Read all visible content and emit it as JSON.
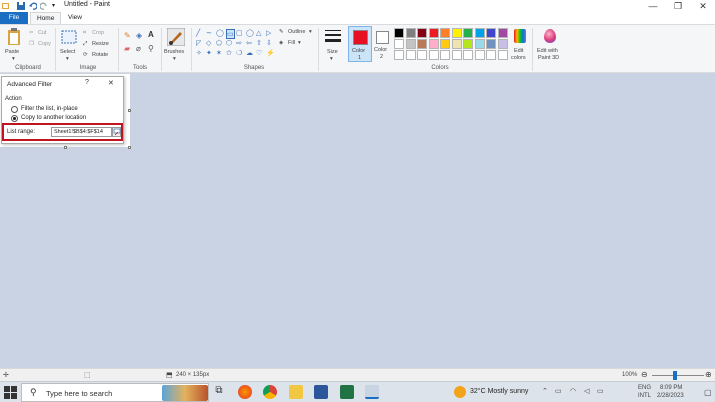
{
  "window": {
    "title": "Untitled - Paint",
    "controls": {
      "minimize": "—",
      "maximize": "❐",
      "close": "✕"
    }
  },
  "tabs": {
    "file": "File",
    "home": "Home",
    "view": "View"
  },
  "ribbon": {
    "clipboard": {
      "label": "Clipboard",
      "paste": "Paste",
      "cut": "Cut",
      "copy": "Copy"
    },
    "image": {
      "label": "Image",
      "select": "Select",
      "crop": "Crop",
      "resize": "Resize",
      "rotate": "Rotate"
    },
    "tools": {
      "label": "Tools"
    },
    "brushes": "Brushes",
    "shapes": {
      "label": "Shapes",
      "outline": "Outline",
      "fill": "Fill"
    },
    "size": "Size",
    "color1": {
      "label": "Color",
      "num": "1",
      "value": "#e81123"
    },
    "color2": {
      "label": "Color",
      "num": "2",
      "value": "#ffffff"
    },
    "colors": {
      "label": "Colors",
      "row1": [
        "#000000",
        "#7f7f7f",
        "#880015",
        "#ed1c24",
        "#ff7f27",
        "#fff200",
        "#22b14c",
        "#00a2e8",
        "#3f48cc",
        "#a349a4"
      ],
      "row2": [
        "#ffffff",
        "#c3c3c3",
        "#b97a57",
        "#ffaec9",
        "#ffc90e",
        "#efe4b0",
        "#b5e61d",
        "#99d9ea",
        "#7092be",
        "#c8bfe7"
      ]
    },
    "edit_colors": {
      "line1": "Edit",
      "line2": "colors"
    },
    "paint3d": {
      "line1": "Edit with",
      "line2": "Paint 3D"
    }
  },
  "dialog": {
    "title": "Advanced Filter",
    "help": "?",
    "close": "✕",
    "action_label": "Action",
    "option1": "Filter the list, in-place",
    "option2": "Copy to another location",
    "list_range_label": "List range:",
    "list_range_value": "Sheet1!$B$4:$F$14"
  },
  "status": {
    "dimensions": "240 × 135px",
    "zoom": "100%"
  },
  "taskbar": {
    "search_placeholder": "Type here to search",
    "weather": "32°C  Mostly sunny",
    "lang1": "ENG",
    "lang2": "INTL",
    "time": "8:09 PM",
    "date": "2/28/2023"
  }
}
